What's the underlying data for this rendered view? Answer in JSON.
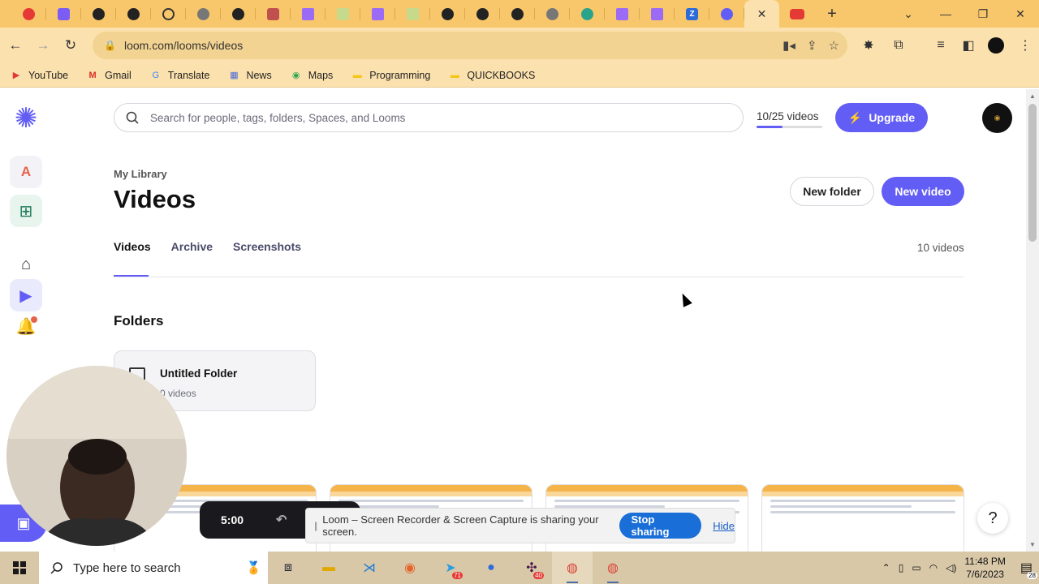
{
  "browser": {
    "tabs": [
      "recording",
      "loom",
      "github",
      "github",
      "refresh",
      "globe",
      "github",
      "app",
      "vite",
      "vite",
      "vite",
      "vite",
      "github",
      "github",
      "github",
      "globe",
      "openai",
      "vite",
      "vite",
      "zoom",
      "loom",
      "active",
      "youtube"
    ],
    "url": "loom.com/looms/videos",
    "bookmarks": [
      {
        "label": "YouTube",
        "icon": "youtube-icon"
      },
      {
        "label": "Gmail",
        "icon": "gmail-icon"
      },
      {
        "label": "Translate",
        "icon": "translate-icon"
      },
      {
        "label": "News",
        "icon": "news-icon"
      },
      {
        "label": "Maps",
        "icon": "maps-icon"
      },
      {
        "label": "Programming",
        "icon": "folder-icon"
      },
      {
        "label": "QUICKBOOKS",
        "icon": "folder-icon"
      }
    ]
  },
  "header": {
    "search_placeholder": "Search for people, tags, folders, Spaces, and Looms",
    "quota_text": "10/25 videos",
    "quota_fraction": 0.4,
    "upgrade_label": "Upgrade"
  },
  "page": {
    "breadcrumb": "My Library",
    "title": "Videos",
    "new_folder_label": "New folder",
    "new_video_label": "New video",
    "tabs": [
      "Videos",
      "Archive",
      "Screenshots"
    ],
    "video_count": "10 videos",
    "folders_heading": "Folders",
    "folder": {
      "name": "Untitled Folder",
      "count": "0 videos"
    }
  },
  "recorder": {
    "timer": "5:00"
  },
  "sharebar": {
    "message": "Loom – Screen Recorder & Screen Capture is sharing your screen.",
    "stop_label": "Stop sharing",
    "hide_label": "Hide"
  },
  "help": {
    "label": "?"
  },
  "taskbar": {
    "search_placeholder": "Type here to search",
    "time": "11:48 PM",
    "date": "7/6/2023",
    "notification_count": "28",
    "telegram_badge": "71",
    "slack_badge": "40"
  },
  "colors": {
    "accent": "#625df5",
    "browser_tab": "#f9c76b",
    "browser_bar": "#fbe1ad"
  }
}
